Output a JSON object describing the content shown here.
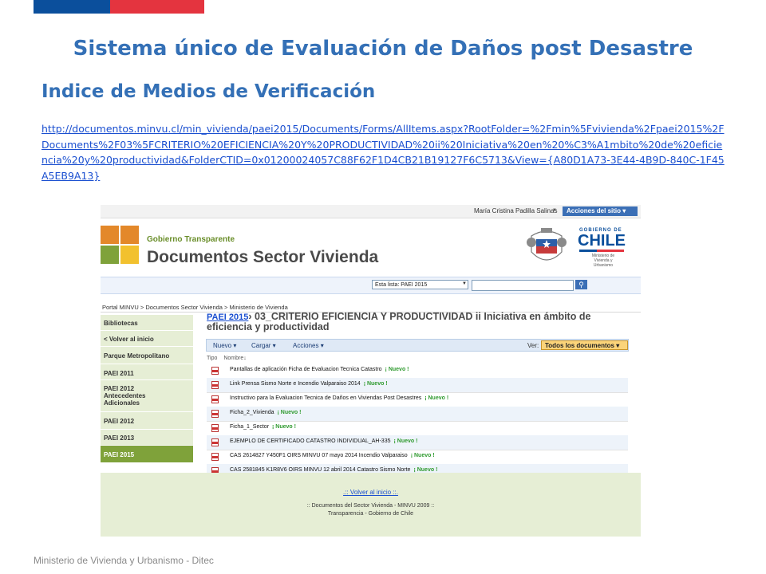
{
  "slide": {
    "title": "Sistema único de  Evaluación de Daños post Desastre",
    "subtitle": "Indice de Medios de Verificación",
    "url": "http://documentos.minvu.cl/min_vivienda/paei2015/Documents/Forms/AllItems.aspx?RootFolder=%2Fmin%5Fvivienda%2Fpaei2015%2FDocuments%2F03%5FCRITERIO%20EFICIENCIA%20Y%20PRODUCTIVIDAD%20ii%20Iniciativa%20en%20%C3%A1mbito%20de%20eficiencia%20y%20productividad&FolderCTID=0x01200024057C88F62F1D4CB21B19127F6C5713&View={A80D1A73-3E44-4B9D-840C-1F45A5EB9A13}",
    "footer": "Ministerio de Vivienda y Urbanismo - Ditec",
    "colors": {
      "accent": "#3470b6",
      "flag_blue": "#0b4f9c",
      "flag_red": "#e4343f"
    }
  },
  "screenshot": {
    "user_name": "María Cristina Padilla Salinas",
    "site_actions": "Acciones del sitio",
    "brand_top": "Gobierno Transparente",
    "brand_title": "Documentos Sector Vivienda",
    "chile_gobierno": "GOBIERNO DE",
    "chile_name": "CHILE",
    "chile_ministry": "Ministerio de Vivienda y Urbanismo",
    "search_scope": "Esta lista: PAEI 2015",
    "breadcrumb": "Portal MINVU > Documentos Sector Vivienda > Ministerio de Vivienda",
    "sidebar": [
      "Bibliotecas",
      "< Volver al inicio",
      "Parque Metropolitano",
      "PAEI 2011",
      "PAEI 2012 Antecedentes Adicionales",
      "PAEI 2012",
      "PAEI 2013",
      "PAEI 2015"
    ],
    "folder_link": "PAEI 2015",
    "folder_title": "› 03_CRITERIO EFICIENCIA Y PRODUCTIVIDAD ii Iniciativa en ámbito de eficiencia y productividad",
    "toolbar": {
      "nuevo": "Nuevo",
      "cargar": "Cargar",
      "acciones": "Acciones",
      "ver": "Ver:",
      "view": "Todos los documentos"
    },
    "columns": {
      "tipo": "Tipo",
      "nombre": "Nombre"
    },
    "new_badge": "¡ Nuevo !",
    "documents": [
      "Pantallas de aplicación Ficha de Evaluacion Tecnica Catastro",
      "Link Prensa Sismo Norte e Incendio Valparaiso 2014",
      "Instructivo para la Evaluacion Tecnica de Daños en Viviendas Post Desastres",
      "Ficha_2_Vivienda",
      "Ficha_1_Sector",
      "EJEMPLO DE CERTIFICADO CATASTRO INDIVIDUAL_AH-335",
      "CAS 2614827 Y450F1 OIRS MINVU 07 mayo 2014 Incendio Valparaiso",
      "CAS 2581845 K1R8V6 OIRS MINVU 12 abril 2014 Catastro Sismo Norte"
    ],
    "footer_link": ".:: Volver al inicio ::.",
    "footer_line1": ":: Documentos del Sector Vivienda - MINVU 2009 ::",
    "footer_line2": "Transparencia - Gobierno de Chile"
  }
}
